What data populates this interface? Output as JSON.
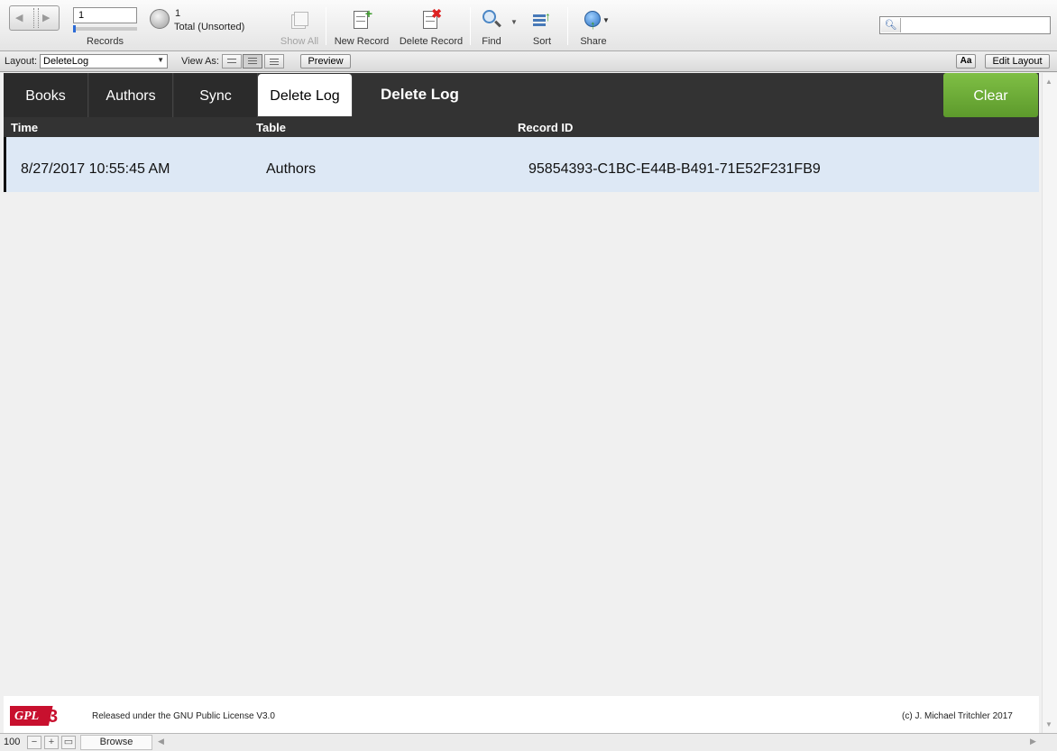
{
  "toolbar": {
    "record_number": "1",
    "records_label": "Records",
    "found_count": "1",
    "total_label": "Total (Unsorted)",
    "show_all_label": "Show All",
    "new_record_label": "New Record",
    "delete_record_label": "Delete Record",
    "find_label": "Find",
    "sort_label": "Sort",
    "share_label": "Share",
    "search_placeholder": ""
  },
  "layout_bar": {
    "layout_label": "Layout:",
    "layout_value": "DeleteLog",
    "view_as_label": "View As:",
    "preview_label": "Preview",
    "aa_label": "Aa",
    "edit_layout_label": "Edit Layout"
  },
  "tabs": [
    {
      "label": "Books"
    },
    {
      "label": "Authors"
    },
    {
      "label": "Sync"
    },
    {
      "label": "Delete Log"
    }
  ],
  "layout_title": "Delete Log",
  "clear_label": "Clear",
  "columns": [
    "Time",
    "Table",
    "Record ID"
  ],
  "rows": [
    {
      "time": "8/27/2017 10:55:45 AM",
      "table": "Authors",
      "record_id": "95854393-C1BC-E44B-B491-71E52F231FB9"
    }
  ],
  "footer": {
    "logo_text": "GPLv3",
    "license_text": "Released under the GNU Public License V3.0",
    "copyright": "(c) J. Michael Tritchler 2017"
  },
  "statusbar": {
    "zoom": "100",
    "mode": "Browse"
  },
  "colors": {
    "header_band": "#333333",
    "clear_button": "#6aa836",
    "selected_row": "#dde8f5"
  }
}
